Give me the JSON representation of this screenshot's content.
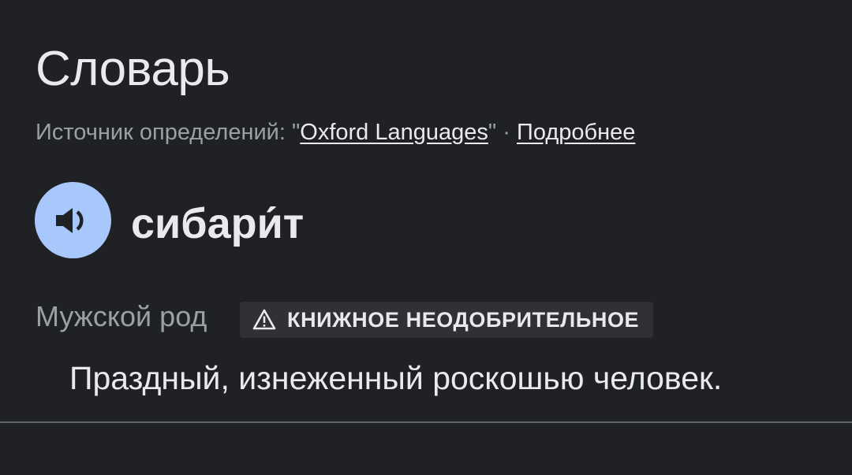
{
  "dictionary": {
    "title": "Словарь",
    "source_prefix": "Источник определений: \"",
    "source_link": "Oxford Languages",
    "source_suffix": "\" · ",
    "more_link": "Подробнее",
    "audio_icon": "speaker-icon",
    "word": "сибари́т",
    "part_of_speech": "Мужской род",
    "label_icon": "warning-icon",
    "usage_label": "КНИЖНОЕ НЕОДОБРИТЕЛЬНОЕ",
    "definition": "Праздный, изнеженный роскошью человек."
  },
  "colors": {
    "background": "#202124",
    "text_primary": "#e8eaed",
    "text_secondary": "#9aa0a6",
    "audio_button": "#a8c7fa",
    "chip_background": "#303134",
    "divider": "#5f6368"
  }
}
